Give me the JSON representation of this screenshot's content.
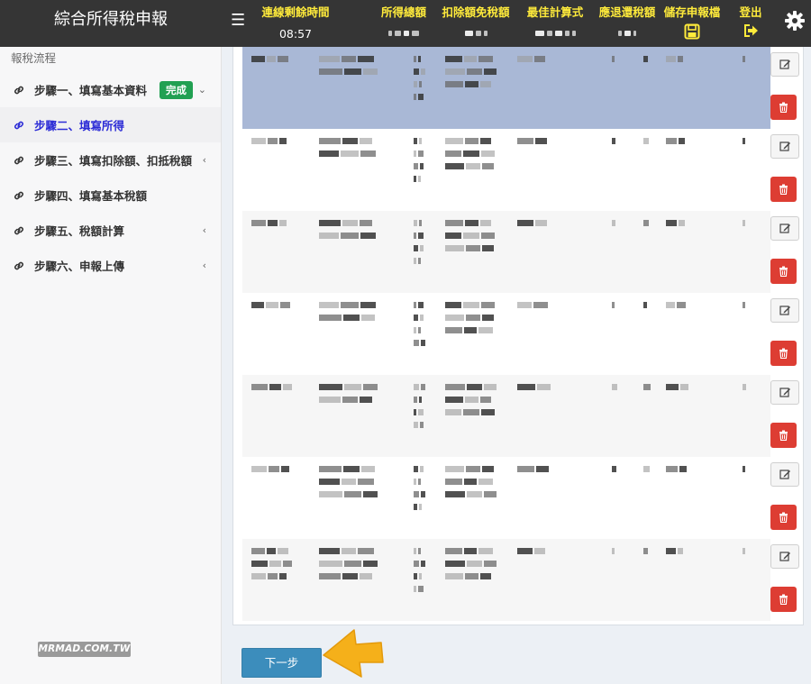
{
  "app": {
    "title": "綜合所得稅申報"
  },
  "header": {
    "menu_icon": "hamburger-icon",
    "stats": [
      {
        "label": "連線剩餘時間",
        "value": "08:57"
      },
      {
        "label": "所得總額",
        "value": ""
      },
      {
        "label": "扣除額免稅額",
        "value": ""
      },
      {
        "label": "最佳計算式",
        "value": ""
      },
      {
        "label": "應退還稅額",
        "value": ""
      }
    ],
    "save_label": "儲存申報檔",
    "logout_label": "登出",
    "settings_icon": "gear-icon"
  },
  "sidebar": {
    "header": "報稅流程",
    "items": [
      {
        "label": "步驟一、填寫基本資料",
        "badge": "完成",
        "chevron": "down",
        "active": false
      },
      {
        "label": "步驟二、填寫所得",
        "chevron": "",
        "active": true
      },
      {
        "label": "步驟三、填寫扣除額、扣抵稅額",
        "chevron": "left",
        "active": false
      },
      {
        "label": "步驟四、填寫基本稅額",
        "chevron": "",
        "active": false
      },
      {
        "label": "步驟五、稅額計算",
        "chevron": "left",
        "active": false
      },
      {
        "label": "步驟六、申報上傳",
        "chevron": "left",
        "active": false
      }
    ]
  },
  "table": {
    "row_count": 7,
    "note": "row contents are pixelated / obscured in the screenshot",
    "colors": {
      "selected_row": "#a9b8d6",
      "delete": "#dd3d33"
    }
  },
  "footer": {
    "next_label": "下一步",
    "watermark": "MRMAD.COM.TW"
  },
  "colors": {
    "header_bg": "#353535",
    "header_label": "#ffeb3b",
    "active_link": "#2b2bd6",
    "badge_green": "#21a052",
    "primary_button": "#3c8dbc",
    "arrow": "#f5b01a"
  }
}
